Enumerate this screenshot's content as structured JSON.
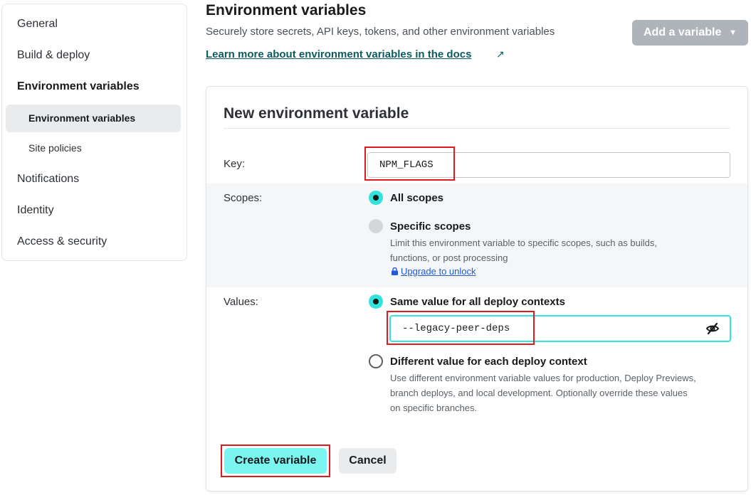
{
  "sidebar": {
    "items": [
      {
        "label": "General"
      },
      {
        "label": "Build & deploy"
      },
      {
        "label": "Environment variables"
      },
      {
        "label": "Notifications"
      },
      {
        "label": "Identity"
      },
      {
        "label": "Access & security"
      }
    ],
    "subitems": [
      {
        "label": "Environment variables",
        "selected": true
      },
      {
        "label": "Site policies",
        "selected": false
      }
    ]
  },
  "header": {
    "title": "Environment variables",
    "subtitle": "Securely store secrets, API keys, tokens, and other environment variables",
    "docs_link": "Learn more about environment variables in the docs",
    "docs_link_icon": "external-link-arrow-icon",
    "add_button": "Add a variable",
    "add_button_icon": "chevron-down-icon"
  },
  "form": {
    "title": "New environment variable",
    "key_label": "Key:",
    "key_value": "NPM_FLAGS",
    "scopes_label": "Scopes:",
    "scope_options": [
      {
        "label": "All scopes",
        "checked": true
      },
      {
        "label": "Specific scopes",
        "checked": false,
        "disabled": true,
        "description_lines": [
          "Limit this environment variable to specific scopes, such as builds,",
          "functions, or post processing"
        ]
      }
    ],
    "upgrade_link": "Upgrade to unlock",
    "upgrade_icon": "lock-icon",
    "values_label": "Values:",
    "value_options": [
      {
        "label": "Same value for all deploy contexts",
        "checked": true
      },
      {
        "label": "Different value for each deploy context",
        "checked": false,
        "description_lines": [
          "Use different environment variable values for production, Deploy Previews,",
          "branch deploys, and local development. Optionally override these values",
          "on specific branches."
        ]
      }
    ],
    "value_input": "--legacy-peer-deps",
    "visibility_icon": "eye-slash-icon",
    "create_button": "Create variable",
    "cancel_button": "Cancel"
  },
  "colors": {
    "accent": "#30e3dd",
    "primary_button": "#7bf5f0",
    "highlight_box": "#e0191f",
    "link": "#0c5c5f",
    "upgrade_link": "#2458d8"
  }
}
